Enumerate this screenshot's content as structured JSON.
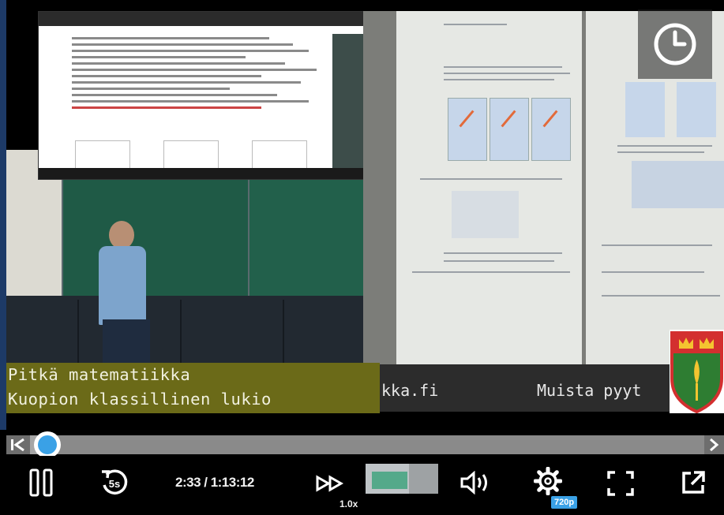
{
  "overlay": {
    "caption_line1": "Pitkä matematiikka",
    "caption_line2": "Kuopion klassillinen lukio",
    "ticker_url": "kka.fi",
    "ticker_message": "Muista pyyt"
  },
  "player": {
    "time_display": "2:33 / 1:13:12",
    "speed": "1.0x",
    "quality": "720p",
    "progress_fraction": 0.035,
    "accent_color": "#3aa1e6"
  },
  "icons": {
    "clock": "clock-icon",
    "seek_start": "skip-start-icon",
    "seek_end": "skip-end-icon",
    "pause": "pause-icon",
    "rewind": "rewind-5-icon",
    "speed": "fast-forward-icon",
    "volume": "volume-icon",
    "settings": "gear-icon",
    "fullscreen": "fullscreen-icon",
    "popout": "external-link-icon"
  }
}
